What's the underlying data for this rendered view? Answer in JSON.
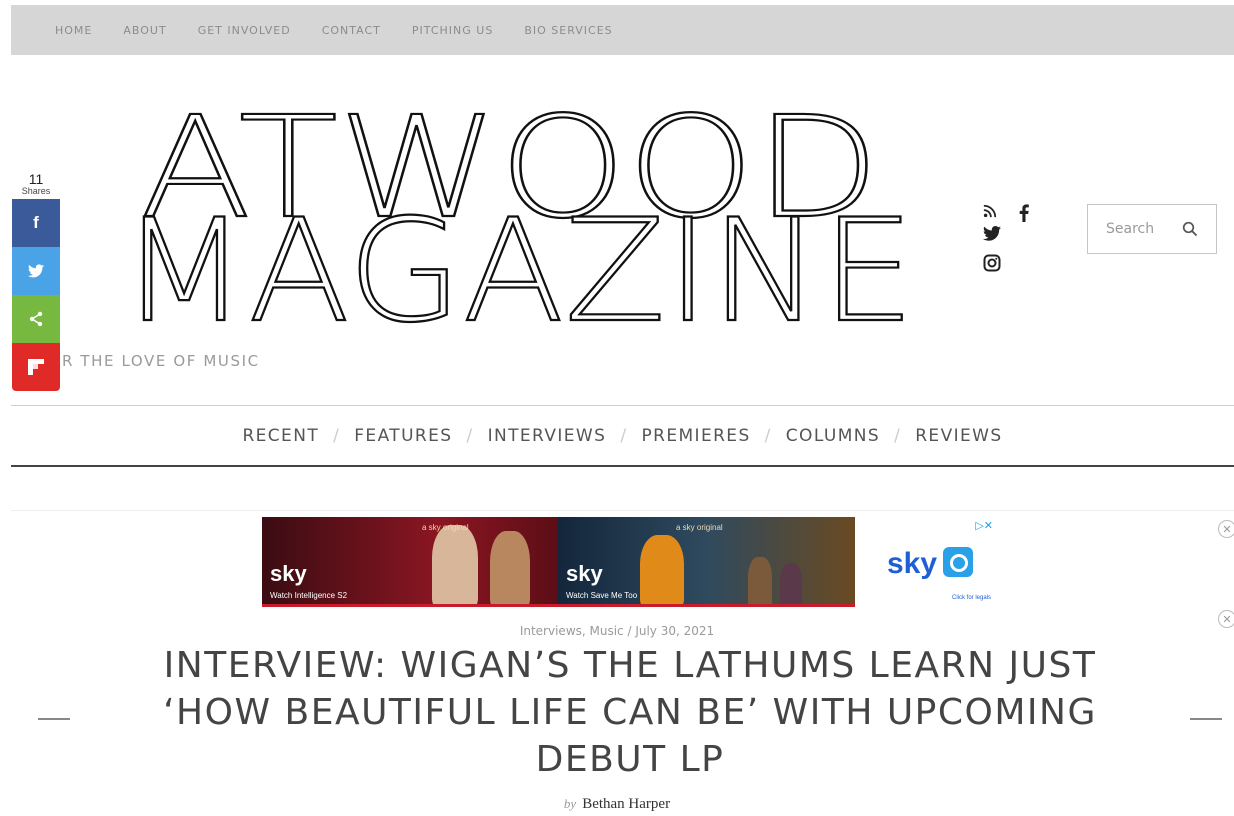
{
  "top_nav": [
    "HOME",
    "ABOUT",
    "GET INVOLVED",
    "CONTACT",
    "PITCHING US",
    "BIO SERVICES"
  ],
  "logo": {
    "line1": "ATWOOD",
    "line2": "MAGAZINE"
  },
  "tagline": "R THE LOVE OF MUSIC",
  "share": {
    "count": "11",
    "label": "Shares"
  },
  "search": {
    "placeholder": "Search"
  },
  "category_nav": [
    "RECENT",
    "FEATURES",
    "INTERVIEWS",
    "PREMIERES",
    "COLUMNS",
    "REVIEWS"
  ],
  "ad": {
    "panel1": {
      "brand": "sky",
      "tag": "a sky original",
      "caption": "Watch Intelligence S2"
    },
    "panel2": {
      "brand": "sky",
      "tag": "a sky original",
      "caption": "Watch Save Me Too"
    },
    "panel3": {
      "brand": "sky",
      "legal": "Click for legals"
    },
    "colors": {
      "panel1": "#8b1622",
      "panel2": "#2f4a5e",
      "brand_blue": "#1f5fd6"
    }
  },
  "article": {
    "meta": "Interviews, Music / July 30, 2021",
    "title": "INTERVIEW: WIGAN’S THE LATHUMS LEARN JUST ‘HOW BEAUTIFUL LIFE CAN BE’ WITH UPCOMING DEBUT LP",
    "by_label": "by",
    "author": "Bethan Harper"
  },
  "colors": {
    "topbar_bg": "#d6d6d6",
    "facebook": "#3b5a9a",
    "twitter": "#4aa3e6",
    "share": "#76b840",
    "flipboard": "#e02a27"
  }
}
